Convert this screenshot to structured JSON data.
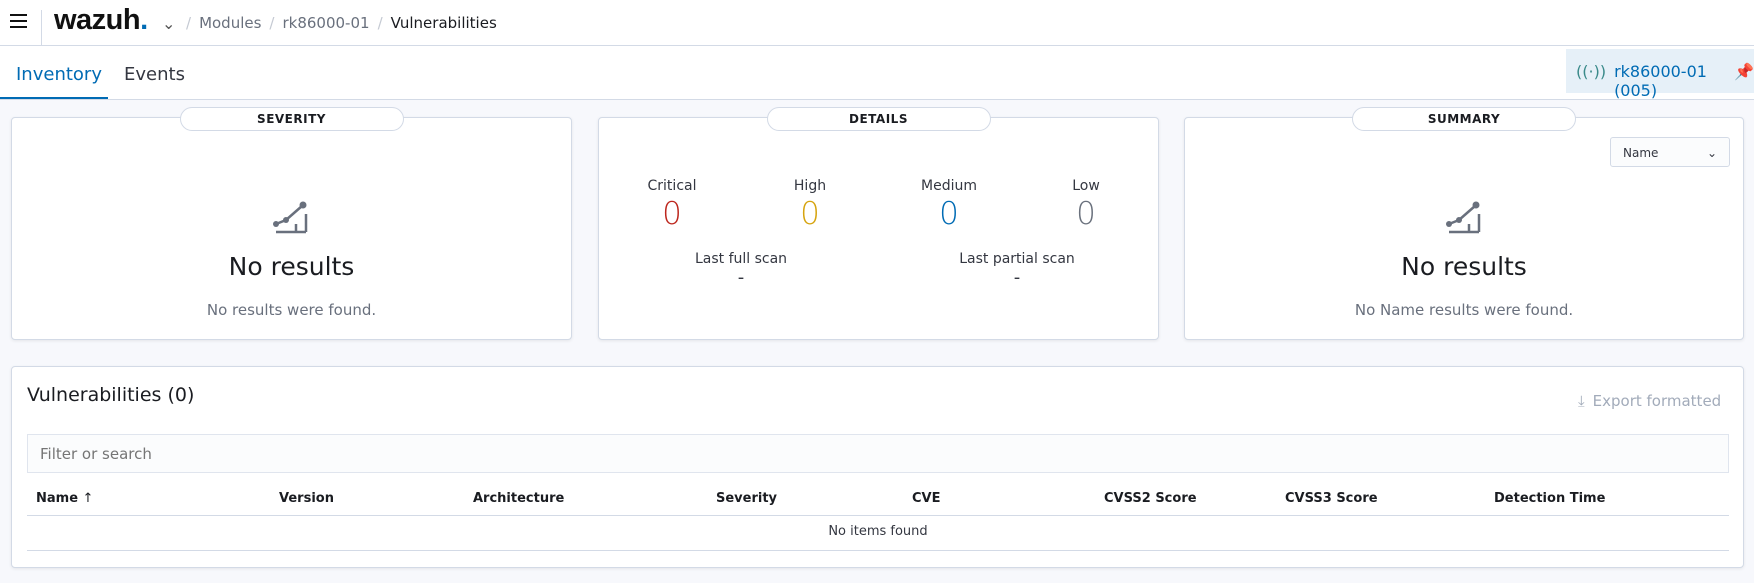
{
  "header": {
    "logo": "wazuh",
    "breadcrumb": [
      "Modules",
      "rk86000-01",
      "Vulnerabilities"
    ]
  },
  "tabs": [
    {
      "label": "Inventory",
      "active": true
    },
    {
      "label": "Events",
      "active": false
    }
  ],
  "agent": {
    "label": "rk86000-01 (005)"
  },
  "severity": {
    "title": "SEVERITY",
    "empty_title": "No results",
    "empty_text": "No results were found."
  },
  "details": {
    "title": "DETAILS",
    "counts": [
      {
        "label": "Critical",
        "value": "0",
        "color": "#bd271e"
      },
      {
        "label": "High",
        "value": "0",
        "color": "#d6a40f"
      },
      {
        "label": "Medium",
        "value": "0",
        "color": "#006bb4"
      },
      {
        "label": "Low",
        "value": "0",
        "color": "#6a717d"
      }
    ],
    "scans": [
      {
        "label": "Last full scan",
        "value": "-"
      },
      {
        "label": "Last partial scan",
        "value": "-"
      }
    ]
  },
  "summary": {
    "title": "SUMMARY",
    "select": "Name",
    "empty_title": "No results",
    "empty_text": "No Name results were found."
  },
  "table": {
    "title": "Vulnerabilities (0)",
    "export": "Export formatted",
    "search_placeholder": "Filter or search",
    "columns": [
      "Name",
      "Version",
      "Architecture",
      "Severity",
      "CVE",
      "CVSS2 Score",
      "CVSS3 Score",
      "Detection Time"
    ],
    "sort_indicator": "↑",
    "empty": "No items found"
  }
}
